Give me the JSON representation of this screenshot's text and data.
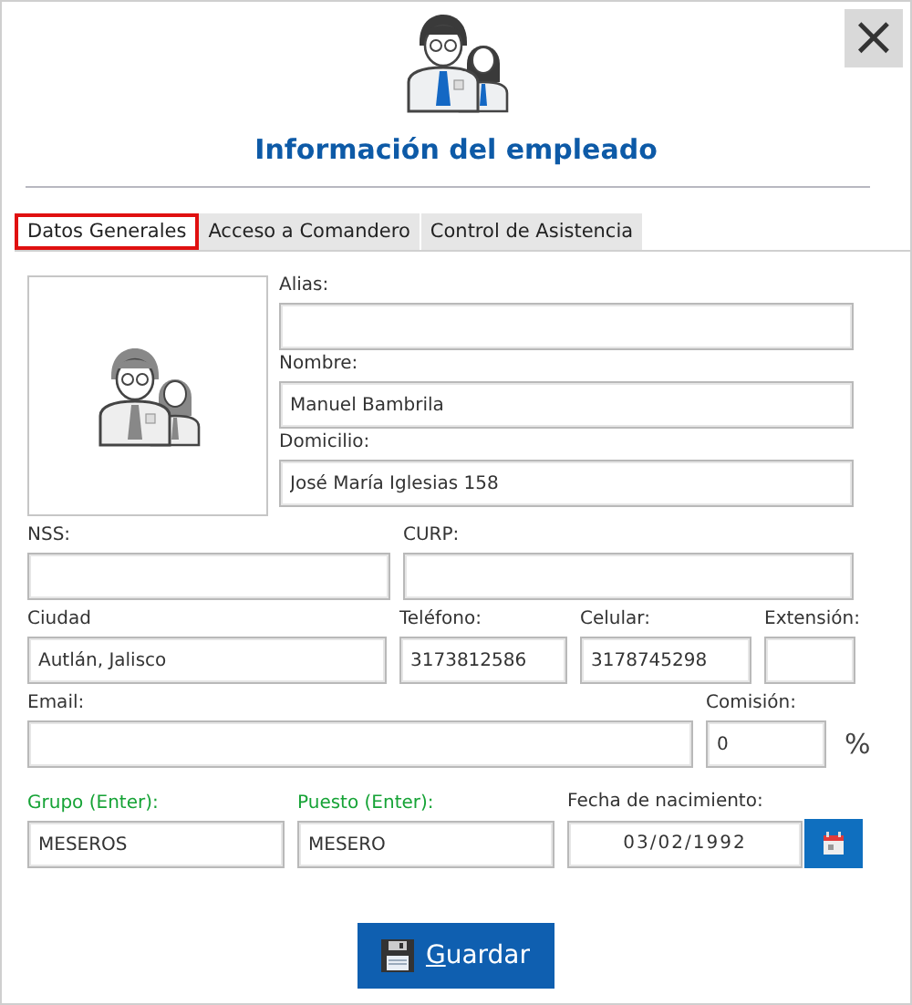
{
  "window": {
    "title": "Información del empleado",
    "close_label": "×"
  },
  "tabs": [
    {
      "label": "Datos Generales",
      "selected": true
    },
    {
      "label": "Acceso a Comandero",
      "selected": false
    },
    {
      "label": "Control de Asistencia",
      "selected": false
    }
  ],
  "photo": {
    "kind": "placeholder"
  },
  "top_fields": [
    {
      "label": "Alias:"
    },
    {
      "label": "Nombre:",
      "value": "Manuel Bambrila"
    },
    {
      "label": "Domicilio:",
      "value": "José María Iglesias 158"
    }
  ],
  "rows": [
    [
      {
        "label": "NSS:",
        "kind": "text"
      },
      {
        "label": "CURP:",
        "kind": "text"
      }
    ],
    [
      {
        "label": "Ciudad",
        "value": "Autlán, Jalisco",
        "kind": "text"
      },
      {
        "label": "Teléfono:",
        "value": "3173812586",
        "kind": "text"
      },
      {
        "label": "Celular:",
        "value": "3178745298",
        "kind": "text"
      },
      {
        "label": "Extensión:",
        "kind": "text"
      }
    ],
    [
      {
        "label": "Email:",
        "kind": "text"
      },
      {
        "label": "Comisión:",
        "value": "0",
        "kind": "percent",
        "suffix": "%"
      }
    ],
    [
      {
        "label": "Grupo (Enter):",
        "value": "MESEROS",
        "kind": "lookup"
      },
      {
        "label": "Puesto (Enter):",
        "value": "MESERO",
        "kind": "lookup"
      },
      {
        "label": "Fecha de nacimiento:",
        "value": "03/02/1992",
        "kind": "date"
      }
    ]
  ],
  "save_button": {
    "label": "Guardar"
  }
}
